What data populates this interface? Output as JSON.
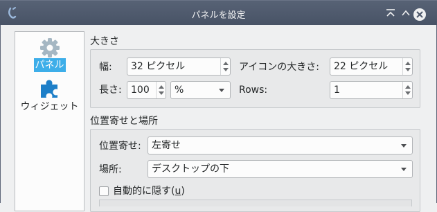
{
  "window": {
    "title": "パネルを設定"
  },
  "sidebar": {
    "items": [
      {
        "label": "パネル",
        "icon": "gear-icon",
        "selected": true
      },
      {
        "label": "ウィジェット",
        "icon": "puzzle-piece-icon",
        "selected": false
      }
    ]
  },
  "size_section": {
    "title": "大きさ",
    "width_label": "幅:",
    "width_value": "32 ピクセル",
    "icon_size_label": "アイコンの大きさ:",
    "icon_size_value": "22 ピクセル",
    "length_label": "長さ:",
    "length_value": "100",
    "length_unit": "%",
    "rows_label": "Rows:",
    "rows_value": "1"
  },
  "position_section": {
    "title": "位置寄せと場所",
    "alignment_label": "位置寄せ:",
    "alignment_value": "左寄せ",
    "location_label": "場所:",
    "location_value": "デスクトップの下",
    "autohide_label": "自動的に隠す(",
    "autohide_mnemonic": "u",
    "autohide_suffix": ")",
    "autohide_checked": false
  },
  "colors": {
    "titlebar": "#4d586b",
    "selection": "#3daee9",
    "window_bg": "#eff0f1"
  }
}
